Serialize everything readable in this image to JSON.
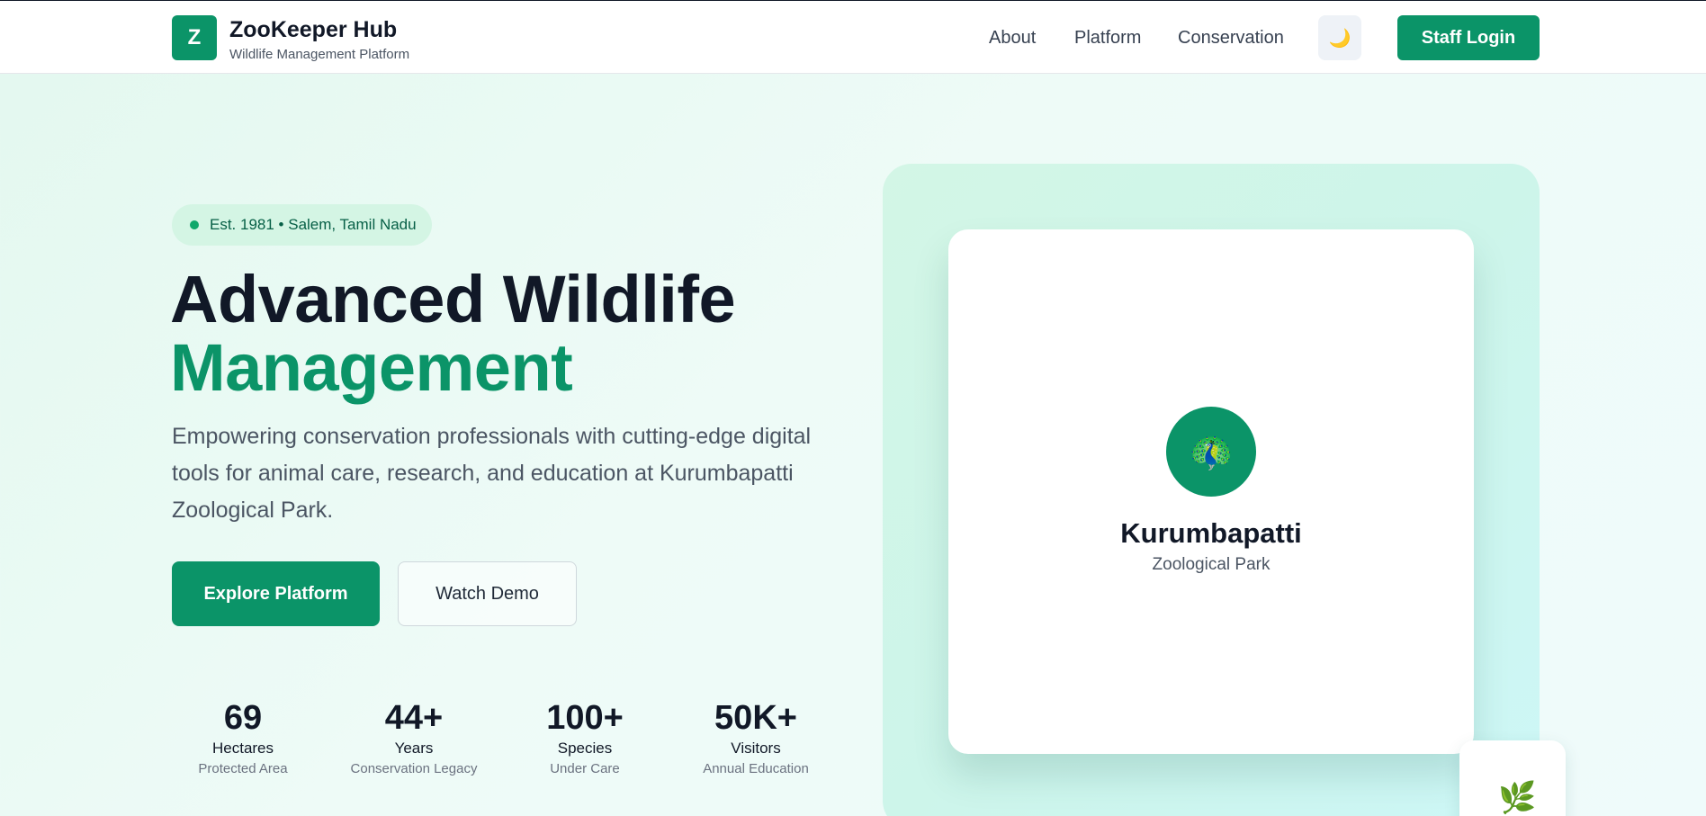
{
  "brand": {
    "logo_letter": "Z",
    "name": "ZooKeeper Hub",
    "tagline": "Wildlife Management Platform",
    "accent_color": "#0b9468"
  },
  "nav": {
    "links": [
      "About",
      "Platform",
      "Conservation"
    ],
    "theme_toggle_icon": "moon-icon",
    "theme_toggle_glyph": "🌙",
    "login_label": "Staff Login"
  },
  "hero": {
    "badge": "Est. 1981 • Salem, Tamil Nadu",
    "title_line1": "Advanced Wildlife",
    "title_line2": "Management",
    "description": "Empowering conservation professionals with cutting-edge digital tools for animal care, research, and education at Kurumbapatti Zoological Park.",
    "primary_button": "Explore Platform",
    "secondary_button": "Watch Demo"
  },
  "stats": [
    {
      "value": "69",
      "label": "Hectares",
      "sub": "Protected Area"
    },
    {
      "value": "44+",
      "label": "Years",
      "sub": "Conservation Legacy"
    },
    {
      "value": "100+",
      "label": "Species",
      "sub": "Under Care"
    },
    {
      "value": "50K+",
      "label": "Visitors",
      "sub": "Annual Education"
    }
  ],
  "park_card": {
    "icon": "peacock-icon",
    "icon_glyph": "🦚",
    "name": "Kurumbapatti",
    "subtitle": "Zoological Park"
  },
  "floating_card": {
    "icon": "herb-icon",
    "icon_glyph": "🌿"
  }
}
